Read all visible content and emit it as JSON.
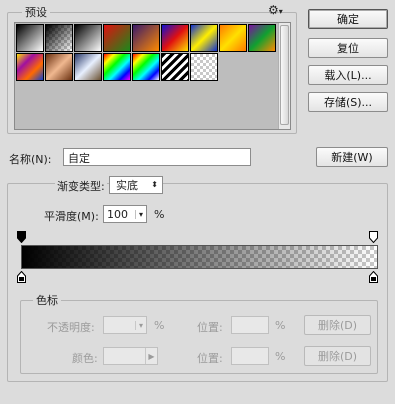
{
  "presets": {
    "title": "预设",
    "menu_icon": "gear-icon",
    "swatches_row1": [
      "fg-bg",
      "fg-transparent",
      "black-white",
      "red-green",
      "violet-orange",
      "blue-red-yellow",
      "blue-yellow-blue",
      "orange-yellow-orange",
      "violet-green-orange"
    ],
    "swatches_row2": [
      "yellow-violet-orange-blue",
      "copper",
      "chrome",
      "spectrum",
      "transparent-rainbow",
      "transparent-stripes",
      "checker"
    ]
  },
  "buttons": {
    "ok": "确定",
    "reset": "复位",
    "load": "载入(L)...",
    "save": "存储(S)...",
    "new": "新建(W)",
    "delete1": "删除(D)",
    "delete2": "删除(D)"
  },
  "name": {
    "label": "名称(N):",
    "value": "自定"
  },
  "gradient": {
    "type_label": "渐变类型:",
    "type_value": "实底",
    "smoothness_label": "平滑度(M):",
    "smoothness_value": "100",
    "smoothness_unit": "%"
  },
  "color_stops": {
    "title": "色标",
    "opacity_label": "不透明度:",
    "opacity_unit": "%",
    "location_label1": "位置:",
    "location_unit1": "%",
    "color_label": "颜色:",
    "location_label2": "位置:",
    "location_unit2": "%"
  },
  "colors": {
    "background": "#dcdcdc",
    "gradient_start": "#000000",
    "gradient_end": "transparent"
  }
}
